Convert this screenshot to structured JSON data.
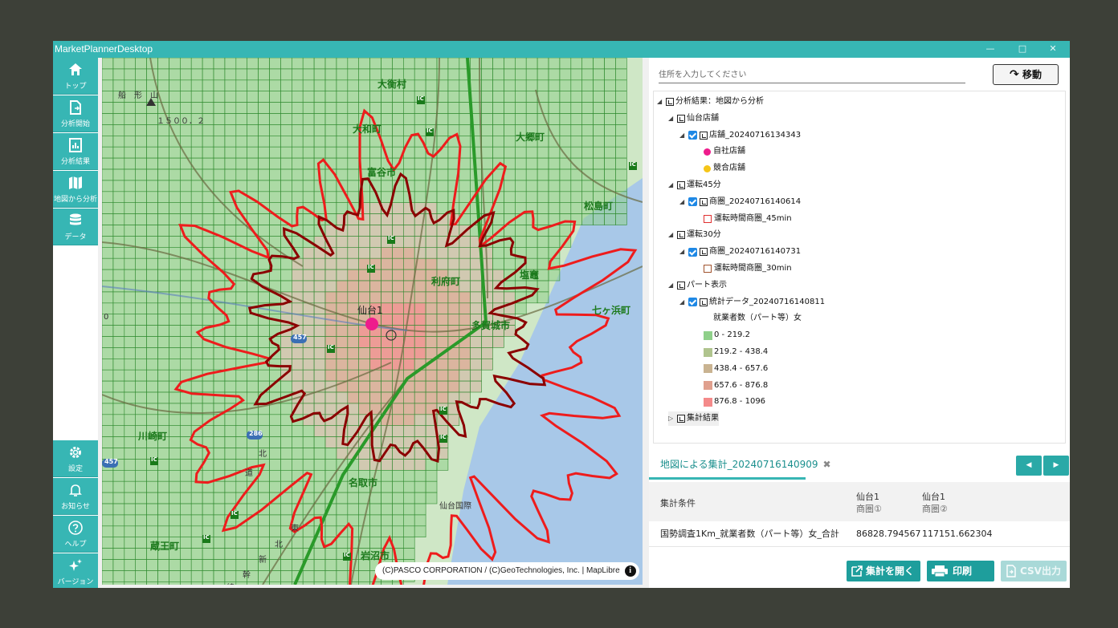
{
  "window": {
    "title": "MarketPlannerDesktop",
    "controls": [
      "—",
      "□",
      "✕"
    ]
  },
  "sidebar": {
    "top_items": [
      {
        "label": "トップ",
        "icon": "home-icon"
      },
      {
        "label": "分析開始",
        "icon": "file-analysis-icon"
      },
      {
        "label": "分析結果",
        "icon": "chart-document-icon"
      },
      {
        "label": "地図から分析",
        "icon": "map-icon"
      },
      {
        "label": "データ",
        "icon": "database-icon"
      }
    ],
    "bottom_items": [
      {
        "label": "設定",
        "icon": "gear-icon"
      },
      {
        "label": "お知らせ",
        "icon": "bell-icon"
      },
      {
        "label": "ヘルプ",
        "icon": "help-icon"
      },
      {
        "label": "バージョン",
        "icon": "sparkle-icon"
      }
    ]
  },
  "map": {
    "attribution": "(C)PASCO CORPORATION / (C)GeoTechnologies, Inc. | MapLibre",
    "store_label": "仙台1",
    "place_labels": [
      {
        "text": "大衡村",
        "color": "#1d7a1d"
      },
      {
        "text": "大和町",
        "color": "#1d7a1d"
      },
      {
        "text": "大郷町",
        "color": "#1d7a1d"
      },
      {
        "text": "富谷市",
        "color": "#1d7a1d"
      },
      {
        "text": "松島町",
        "color": "#1d7a1d"
      },
      {
        "text": "利府町",
        "color": "#1d7a1d"
      },
      {
        "text": "塩竈",
        "color": "#1d7a1d"
      },
      {
        "text": "七ヶ浜町",
        "color": "#1d7a1d"
      },
      {
        "text": "多賀城市",
        "color": "#1d7a1d"
      },
      {
        "text": "川崎町",
        "color": "#1d7a1d"
      },
      {
        "text": "名取市",
        "color": "#1d7a1d"
      },
      {
        "text": "蔵王町",
        "color": "#1d7a1d"
      },
      {
        "text": "岩沼市",
        "color": "#1d7a1d"
      },
      {
        "text": "船　形　山",
        "color": "#333333"
      },
      {
        "text": "１５００．２",
        "color": "#333333"
      },
      {
        "text": "仙台国際",
        "color": "#333333"
      },
      {
        "text": "北",
        "color": "#333333"
      },
      {
        "text": "道",
        "color": "#333333"
      },
      {
        "text": "東",
        "color": "#333333"
      },
      {
        "text": "北",
        "color": "#333333"
      },
      {
        "text": "新",
        "color": "#333333"
      },
      {
        "text": "幹",
        "color": "#333333"
      },
      {
        "text": "線",
        "color": "#333333"
      },
      {
        "text": "0",
        "color": "#333333"
      }
    ],
    "route_shields": [
      "457",
      "286",
      "457"
    ],
    "ic_label": "IC",
    "colors": {
      "land": "#cfe7c6",
      "sea": "#a8c8e8",
      "grid_fill": "#8fd08a",
      "grid_line": "#2f8a2f",
      "area45": "#ee1c1c",
      "area30": "#8b0000",
      "own_store": "#ee1c8c"
    }
  },
  "panel": {
    "address_placeholder": "住所を入力してください",
    "move_button": "移動",
    "tree": [
      {
        "text": "分析結果：地図から分析",
        "arrow": "◢",
        "level": 0,
        "kind": "root"
      },
      {
        "text": "仙台店舗",
        "arrow": "◢",
        "level": 1,
        "kind": "group"
      },
      {
        "text": "店舗_20240716134343",
        "arrow": "◢",
        "level": 2,
        "kind": "layer",
        "checked": true
      },
      {
        "text": "自社店舗",
        "level": 3,
        "kind": "dot",
        "color": "#ee1c8c"
      },
      {
        "text": "競合店舗",
        "level": 3,
        "kind": "dot",
        "color": "#f5c518"
      },
      {
        "text": "運転45分",
        "arrow": "◢",
        "level": 1,
        "kind": "group"
      },
      {
        "text": "商圏_20240716140614",
        "arrow": "◢",
        "level": 2,
        "kind": "layer",
        "checked": true
      },
      {
        "text": "運転時間商圏_45min",
        "level": 3,
        "kind": "outline",
        "color": "#e03030"
      },
      {
        "text": "運転30分",
        "arrow": "◢",
        "level": 1,
        "kind": "group"
      },
      {
        "text": "商圏_20240716140731",
        "arrow": "◢",
        "level": 2,
        "kind": "layer",
        "checked": true
      },
      {
        "text": "運転時間商圏_30min",
        "level": 3,
        "kind": "outline",
        "color": "#a0522d"
      },
      {
        "text": "パート表示",
        "arrow": "◢",
        "level": 1,
        "kind": "group"
      },
      {
        "text": "統計データ_20240716140811",
        "arrow": "◢",
        "level": 2,
        "kind": "layer",
        "checked": true
      },
      {
        "text": "就業者数（パート等）女",
        "level": 3,
        "kind": "text"
      },
      {
        "text": "0 - 219.2",
        "level": 3,
        "kind": "swatch",
        "color": "#8fd08a"
      },
      {
        "text": "219.2 - 438.4",
        "level": 3,
        "kind": "swatch",
        "color": "#b0c48e"
      },
      {
        "text": "438.4 - 657.6",
        "level": 3,
        "kind": "swatch",
        "color": "#c9b391"
      },
      {
        "text": "657.6 - 876.8",
        "level": 3,
        "kind": "swatch",
        "color": "#e0a08e"
      },
      {
        "text": "876.8 - 1096",
        "level": 3,
        "kind": "swatch",
        "color": "#f48a8a"
      },
      {
        "text": "集計結果",
        "arrow": "▷",
        "level": 1,
        "kind": "group"
      }
    ],
    "tab": {
      "label": "地図による集計_20240716140909",
      "close": "✖"
    },
    "pager": {
      "prev": "◀",
      "next": "▶"
    },
    "table": {
      "header": {
        "condition": "集計条件",
        "col1_line1": "仙台1",
        "col1_line2": "商圏①",
        "col2_line1": "仙台1",
        "col2_line2": "商圏②"
      },
      "rows": [
        {
          "condition": "国勢調査1Km_就業者数（パート等）女_合計",
          "v1": "86828.794567",
          "v2": "117151.662304"
        }
      ]
    },
    "actions": {
      "open": "集計を開く",
      "print": "印刷",
      "csv": "CSV出力"
    }
  }
}
